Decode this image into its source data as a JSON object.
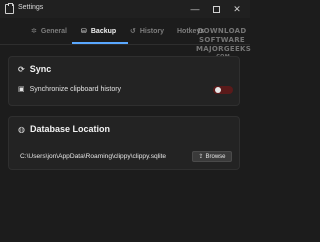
{
  "window": {
    "title": "Settings",
    "minimize_glyph": "—",
    "close_glyph": "✕"
  },
  "tabs": [
    {
      "label": "General",
      "icon": "gear-icon",
      "glyph": "✲",
      "active": false
    },
    {
      "label": "Backup",
      "icon": "backup-icon",
      "glyph": "⛁",
      "active": true
    },
    {
      "label": "History",
      "icon": "history-icon",
      "glyph": "↺",
      "active": false
    },
    {
      "label": "Hotkeys",
      "icon": "keyboard-icon",
      "glyph": "",
      "active": false
    }
  ],
  "watermark": {
    "lines": [
      "DOWNLOAD",
      "SOFTWARE",
      "MAJORGEEKS",
      ".COM"
    ]
  },
  "sync": {
    "title": "Sync",
    "title_glyph": "⟳",
    "setting_label": "Synchronize clipboard history",
    "setting_glyph": "▣",
    "toggle_on": false
  },
  "database": {
    "title": "Database Location",
    "title_glyph": "◍",
    "path": "C:\\Users\\jon\\AppData\\Roaming\\clippy\\clippy.sqlite",
    "browse_label": "Browse",
    "browse_glyph": "⇪"
  },
  "colors": {
    "accent": "#5aa8ff",
    "background": "#1c1c1c",
    "card": "#232323",
    "toggle_off": "#5a1a1a"
  }
}
